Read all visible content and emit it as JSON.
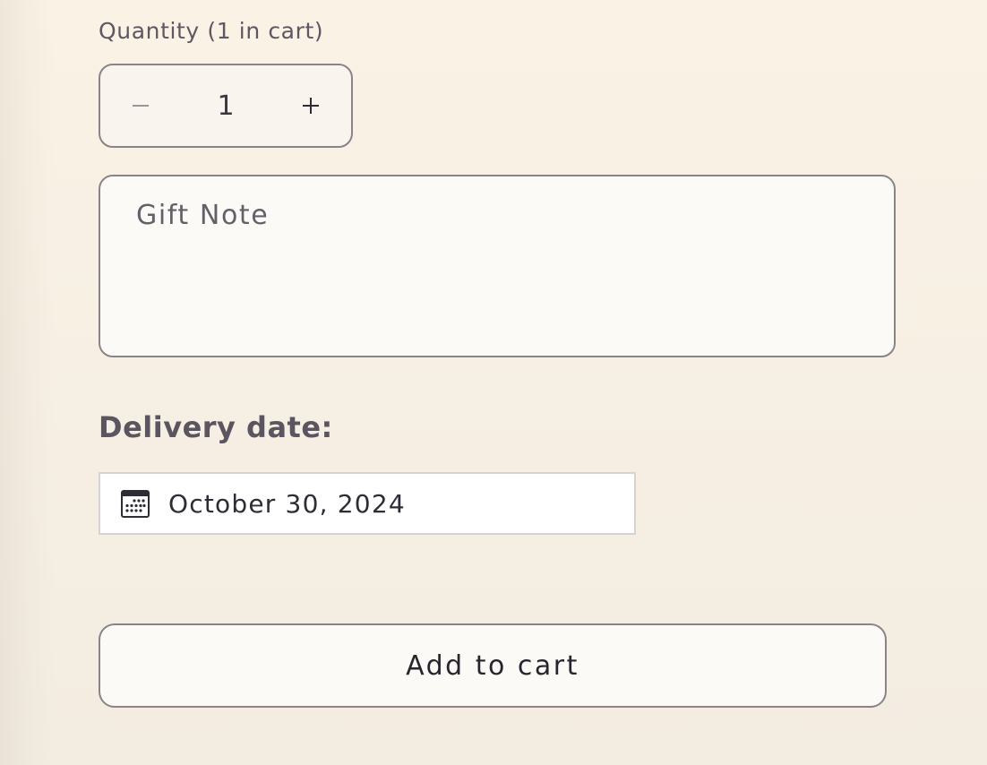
{
  "quantity": {
    "label": "Quantity (1 in cart)",
    "value": "1",
    "decrement_icon": "minus-icon",
    "increment_icon": "plus-icon"
  },
  "gift_note": {
    "placeholder": "Gift Note"
  },
  "delivery": {
    "label": "Delivery date:",
    "date_value": "October 30, 2024",
    "icon": "calendar-icon"
  },
  "cart": {
    "add_label": "Add to cart"
  },
  "colors": {
    "background": "#faf2e5",
    "border": "#8a8488",
    "text_dark": "#2f2c35",
    "text_muted": "#5d5862"
  }
}
